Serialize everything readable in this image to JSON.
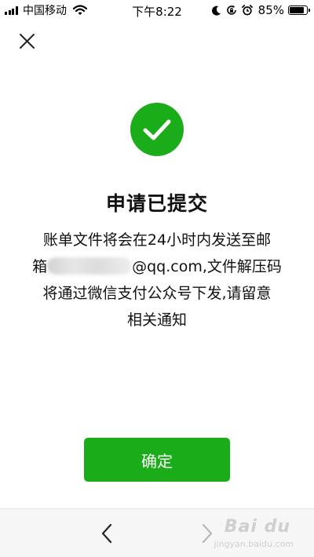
{
  "status_bar": {
    "carrier": "中国移动",
    "time": "下午8:22",
    "battery_percent": "85%",
    "battery_level": 0.85,
    "icons": [
      "signal-icon",
      "wifi-icon",
      "moon-icon",
      "rotation-lock-icon",
      "alarm-icon",
      "battery-icon"
    ]
  },
  "header": {
    "close_icon": "close-icon"
  },
  "result": {
    "icon": "checkmark-icon",
    "title": "申请已提交",
    "message_line1": "账单文件将会在24小时内发送至邮",
    "message_prefix": "箱",
    "message_email_suffix": "@qq.com,文件解压码",
    "message_line3": "将通过微信支付公众号下发,请留意",
    "message_line4": "相关通知",
    "accent_color": "#1aad19"
  },
  "actions": {
    "confirm_label": "确定"
  },
  "bottom_nav": {
    "back_icon": "chevron-left-icon",
    "forward_icon": "chevron-right-icon",
    "watermark": "Bai du",
    "watermark_sub": "jingyan.baidu.com"
  }
}
